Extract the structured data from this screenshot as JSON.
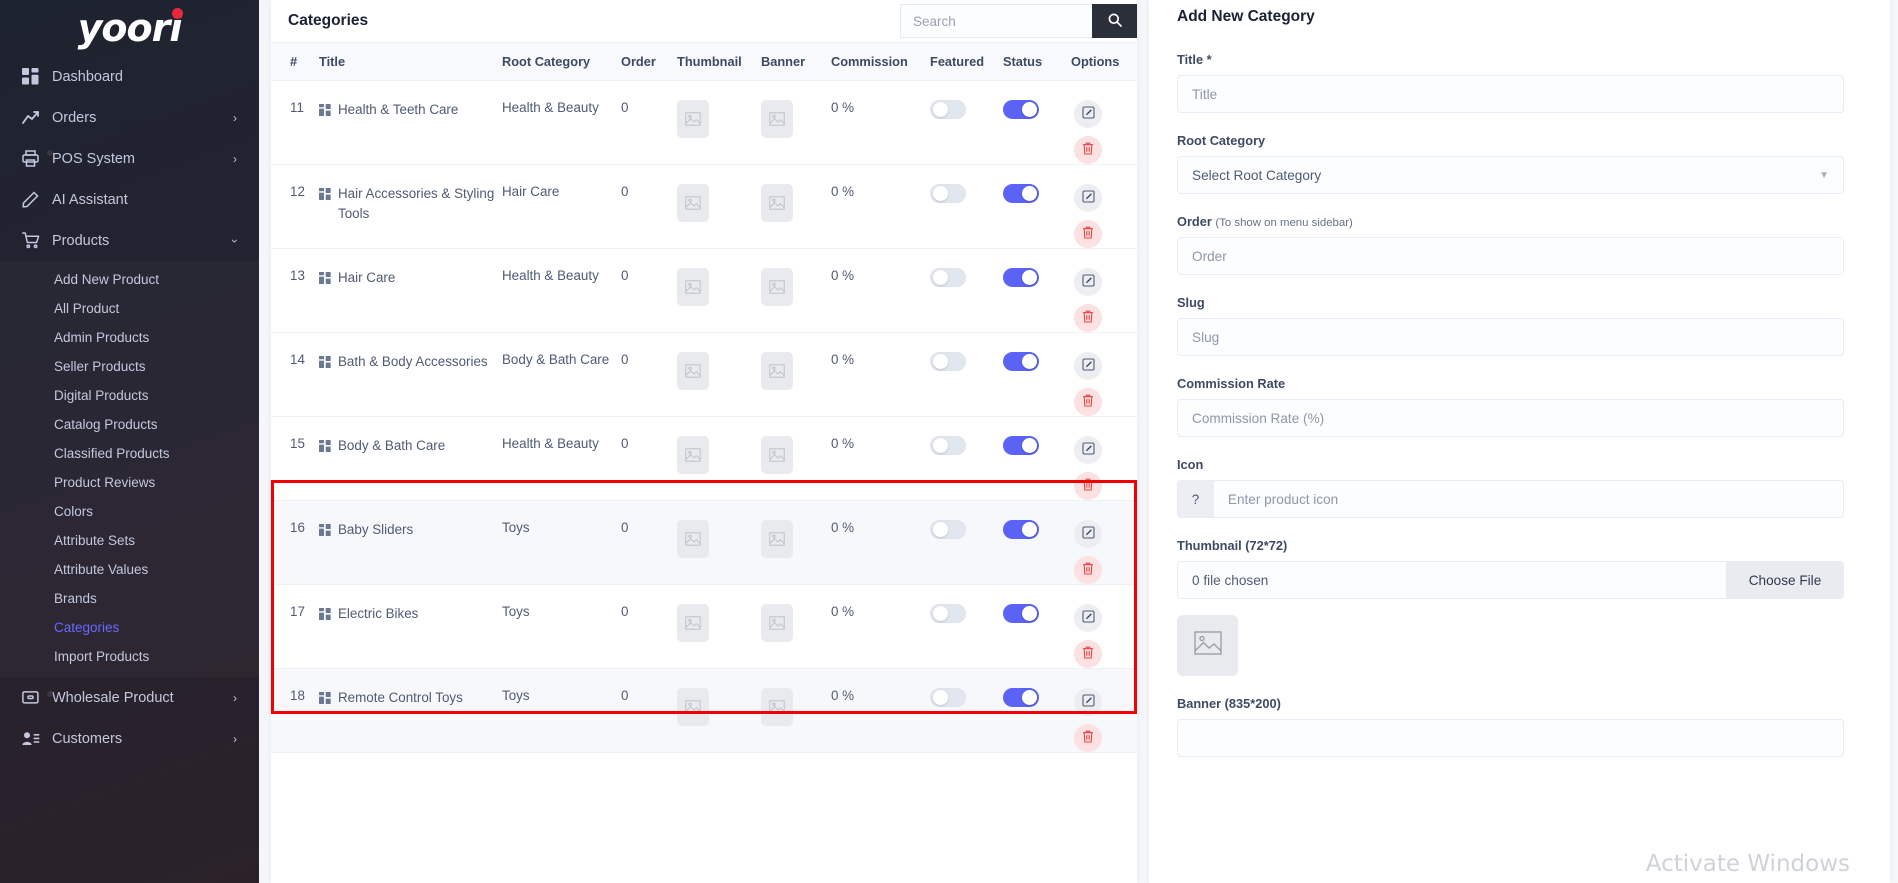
{
  "brand": {
    "name": "yoori"
  },
  "sidebar": {
    "items": [
      {
        "label": "Dashboard",
        "icon": "dashboard-icon",
        "chevron": "",
        "dot": false
      },
      {
        "label": "Orders",
        "icon": "orders-icon",
        "chevron": "›",
        "dot": false
      },
      {
        "label": "POS System",
        "icon": "printer-icon",
        "chevron": "›",
        "dot": true
      },
      {
        "label": "AI Assistant",
        "icon": "pencil-icon",
        "chevron": "",
        "dot": false
      },
      {
        "label": "Products",
        "icon": "cart-icon",
        "chevron": "›",
        "dot": false,
        "expanded": true
      }
    ],
    "submenu": [
      {
        "label": "Add New Product",
        "active": false
      },
      {
        "label": "All Product",
        "active": false
      },
      {
        "label": "Admin Products",
        "active": false
      },
      {
        "label": "Seller Products",
        "active": false
      },
      {
        "label": "Digital Products",
        "active": false
      },
      {
        "label": "Catalog Products",
        "active": false
      },
      {
        "label": "Classified Products",
        "active": false
      },
      {
        "label": "Product Reviews",
        "active": false
      },
      {
        "label": "Colors",
        "active": false
      },
      {
        "label": "Attribute Sets",
        "active": false
      },
      {
        "label": "Attribute Values",
        "active": false
      },
      {
        "label": "Brands",
        "active": false
      },
      {
        "label": "Categories",
        "active": true
      },
      {
        "label": "Import Products",
        "active": false
      }
    ],
    "bottom_items": [
      {
        "label": "Wholesale Product",
        "icon": "wholesale-icon",
        "chevron": "›",
        "dot": true
      },
      {
        "label": "Customers",
        "icon": "customers-icon",
        "chevron": "›",
        "dot": false
      }
    ]
  },
  "table_panel": {
    "title": "Categories",
    "search": {
      "placeholder": "Search",
      "value": ""
    },
    "columns": [
      "#",
      "Title",
      "Root Category",
      "Order",
      "Thumbnail",
      "Banner",
      "Commission",
      "Featured",
      "Status",
      "Options"
    ],
    "rows": [
      {
        "id": "11",
        "title": "Health & Teeth Care",
        "root": "Health & Beauty",
        "order": "0",
        "commission": "0 %",
        "featured": false,
        "status": true,
        "highlighted": false
      },
      {
        "id": "12",
        "title": "Hair Accessories & Styling Tools",
        "root": "Hair Care",
        "order": "0",
        "commission": "0 %",
        "featured": false,
        "status": true,
        "highlighted": false
      },
      {
        "id": "13",
        "title": "Hair Care",
        "root": "Health & Beauty",
        "order": "0",
        "commission": "0 %",
        "featured": false,
        "status": true,
        "highlighted": false
      },
      {
        "id": "14",
        "title": "Bath & Body Accessories",
        "root": "Body & Bath Care",
        "order": "0",
        "commission": "0 %",
        "featured": false,
        "status": true,
        "highlighted": false
      },
      {
        "id": "15",
        "title": "Body & Bath Care",
        "root": "Health & Beauty",
        "order": "0",
        "commission": "0 %",
        "featured": false,
        "status": true,
        "highlighted": false
      },
      {
        "id": "16",
        "title": "Baby Sliders",
        "root": "Toys",
        "order": "0",
        "commission": "0 %",
        "featured": false,
        "status": true,
        "highlighted": true
      },
      {
        "id": "17",
        "title": "Electric Bikes",
        "root": "Toys",
        "order": "0",
        "commission": "0 %",
        "featured": false,
        "status": true,
        "highlighted": false
      },
      {
        "id": "18",
        "title": "Remote Control Toys",
        "root": "Toys",
        "order": "0",
        "commission": "0 %",
        "featured": false,
        "status": true,
        "highlighted": true
      }
    ]
  },
  "form": {
    "title": "Add New Category",
    "title_label": "Title *",
    "title_placeholder": "Title",
    "root_label": "Root Category",
    "root_selected": "Select Root Category",
    "order_label": "Order ",
    "order_hint": "(To show on menu sidebar)",
    "order_placeholder": "Order",
    "slug_label": "Slug",
    "slug_placeholder": "Slug",
    "commission_label": "Commission Rate",
    "commission_placeholder": "Commission Rate (%)",
    "icon_label": "Icon",
    "icon_prefix": "?",
    "icon_placeholder": "Enter product icon",
    "thumbnail_label": "Thumbnail (72*72)",
    "thumbnail_file_status": "0 file chosen",
    "choose_file_label": "Choose File",
    "banner_label": "Banner (835*200)"
  },
  "watermark": "Activate Windows",
  "colors": {
    "accent": "#5a63f5",
    "sidebar_active": "#6a6afc",
    "highlight_box": "#f40000",
    "delete": "#f04343",
    "search_button": "#2b2f3a"
  }
}
